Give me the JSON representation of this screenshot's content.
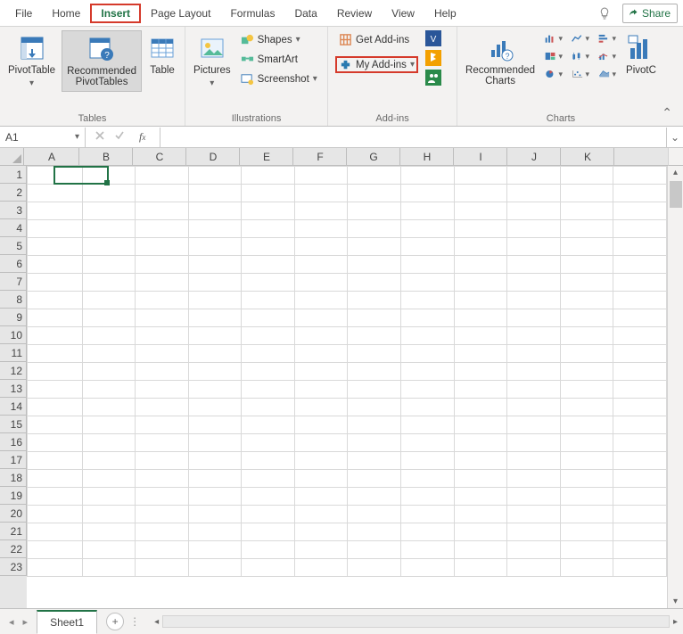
{
  "tabs": {
    "file": "File",
    "home": "Home",
    "insert": "Insert",
    "page_layout": "Page Layout",
    "formulas": "Formulas",
    "data": "Data",
    "review": "Review",
    "view": "View",
    "help": "Help",
    "share": "Share"
  },
  "ribbon": {
    "tables": {
      "label": "Tables",
      "pivot": "PivotTable",
      "recommended": "Recommended\nPivotTables",
      "table": "Table"
    },
    "illustrations": {
      "label": "Illustrations",
      "pictures": "Pictures",
      "shapes": "Shapes",
      "smartart": "SmartArt",
      "screenshot": "Screenshot"
    },
    "addins": {
      "label": "Add-ins",
      "get": "Get Add-ins",
      "my": "My Add-ins"
    },
    "charts": {
      "label": "Charts",
      "recommended": "Recommended\nCharts",
      "pivotchart": "PivotC"
    }
  },
  "formula_bar": {
    "namebox": "A1",
    "formula": ""
  },
  "columns": [
    "A",
    "B",
    "C",
    "D",
    "E",
    "F",
    "G",
    "H",
    "I",
    "J",
    "K"
  ],
  "row_count": 23,
  "sheet_tabs": {
    "active": "Sheet1"
  }
}
